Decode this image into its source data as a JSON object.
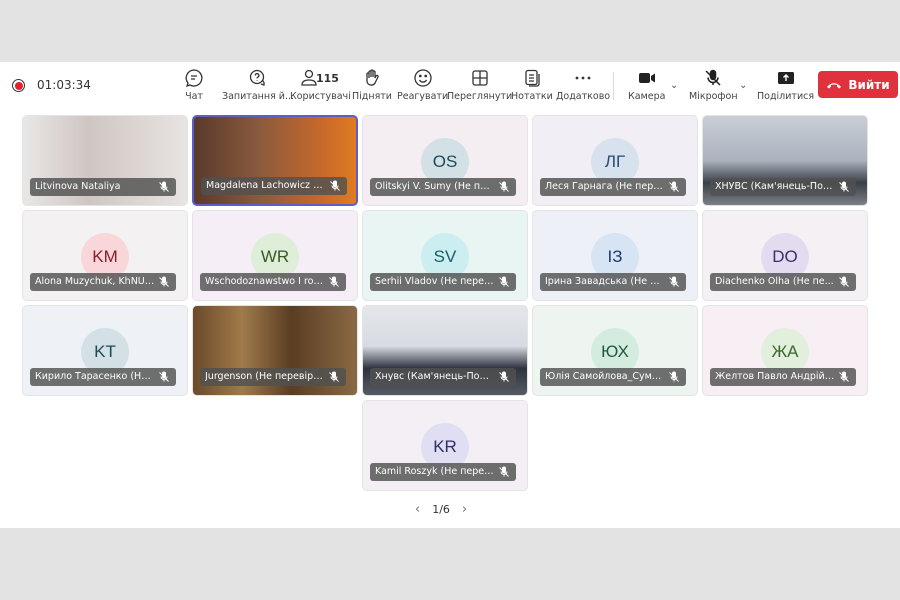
{
  "toolbar": {
    "timer": "01:03:34",
    "participant_count": "115",
    "buttons": [
      {
        "id": "chat",
        "label": "Чат",
        "icon": "chat-icon"
      },
      {
        "id": "qa",
        "label": "Запитання й...",
        "icon": "question-icon"
      },
      {
        "id": "people",
        "label": "Користувачі",
        "icon": "people-icon"
      },
      {
        "id": "raise",
        "label": "Підняти",
        "icon": "hand-icon"
      },
      {
        "id": "react",
        "label": "Реагувати",
        "icon": "smile-icon"
      },
      {
        "id": "view",
        "label": "Переглянути",
        "icon": "grid-icon"
      },
      {
        "id": "notes",
        "label": "Нотатки",
        "icon": "notes-icon"
      },
      {
        "id": "more",
        "label": "Додатково",
        "icon": "more-icon"
      },
      {
        "id": "camera",
        "label": "Камера",
        "icon": "camera-icon"
      },
      {
        "id": "mic",
        "label": "Мікрофон",
        "icon": "mic-off-icon"
      },
      {
        "id": "share",
        "label": "Поділитися",
        "icon": "share-icon"
      }
    ],
    "leave_label": "Вийти",
    "leave_color": "#e0323c"
  },
  "tiles": [
    {
      "name": "Litvinova Nataliya",
      "type": "video",
      "bg": "linear-gradient(90deg,#e9e7e6,#cfc6c2 40%,#e8e4e2)"
    },
    {
      "name": "Magdalena Lachowicz (Не п...",
      "type": "video",
      "bg": "linear-gradient(90deg,#5a3a2a,#8a5a3e 40%,#c86a2a 80%,#e07b20)",
      "active": true
    },
    {
      "name": "Olitskyi V. Sumy (Не пере...",
      "type": "avatar",
      "initials": "OS",
      "bg": "#f4eef2",
      "avbg": "#d3e0e6",
      "avfg": "#1c4a55"
    },
    {
      "name": "Леся Гарнага (Не перев...",
      "type": "avatar",
      "initials": "ЛГ",
      "bg": "#f2eef5",
      "avbg": "#d7e2ee",
      "avfg": "#2a4b6e"
    },
    {
      "name": "ХНУВС (Кам'янець-Поді...",
      "type": "video",
      "bg": "linear-gradient(180deg,#c9ced6,#aab2bd 50%,#3b3f48 75%,#7b7f86)"
    },
    {
      "name": "Alona Muzychuk, KhNUI...",
      "type": "avatar",
      "initials": "KM",
      "bg": "#f4f1f3",
      "avbg": "#f8d6d9",
      "avfg": "#8a1f2c"
    },
    {
      "name": "Wschodoznawstwo I rok...",
      "type": "avatar",
      "initials": "WR",
      "bg": "#f6eef6",
      "avbg": "#dfeed9",
      "avfg": "#355a25"
    },
    {
      "name": "Serhii Vladov (Не перев...",
      "type": "avatar",
      "initials": "SV",
      "bg": "#e9f5f3",
      "avbg": "#cdeef0",
      "avfg": "#136066"
    },
    {
      "name": "Ірина Завадська (Не пе...",
      "type": "avatar",
      "initials": "ІЗ",
      "bg": "#eef0f7",
      "avbg": "#d6e4f3",
      "avfg": "#1d3a6b"
    },
    {
      "name": "Diachenko Olha (Не пе...",
      "type": "avatar",
      "initials": "DO",
      "bg": "#f4f0f4",
      "avbg": "#e3dcf0",
      "avfg": "#3d2e6a"
    },
    {
      "name": "Кирило Тарасенко (Не ...",
      "type": "avatar",
      "initials": "KT",
      "bg": "#eef1f5",
      "avbg": "#d3e0e6",
      "avfg": "#1c4a55"
    },
    {
      "name": "Jurgenson (Не перевірено)",
      "type": "video",
      "bg": "linear-gradient(90deg,#6b4a2a,#a07a4a 30%,#5a3d22 60%,#8a6a44)"
    },
    {
      "name": "Хнувс (Кам'янець-Поді...",
      "type": "video",
      "bg": "linear-gradient(180deg,#e4e6ea,#d7dbe2 45%,#2f3340 70%,#555a63)"
    },
    {
      "name": "Юлія Самойлова_Сумс...",
      "type": "avatar",
      "initials": "ЮХ",
      "bg": "#eef5f1",
      "avbg": "#d3ecdf",
      "avfg": "#1d5a3b"
    },
    {
      "name": "Желтов Павло Андрійо...",
      "type": "avatar",
      "initials": "ЖА",
      "bg": "#f7eff3",
      "avbg": "#e1efdc",
      "avfg": "#3a6a2a"
    },
    {
      "name": "Kamil Roszyk (Не перев...",
      "type": "avatar",
      "initials": "KR",
      "bg": "#f4eff5",
      "avbg": "#e0def2",
      "avfg": "#2b2f6a"
    }
  ],
  "pager": {
    "label": "1/6"
  }
}
